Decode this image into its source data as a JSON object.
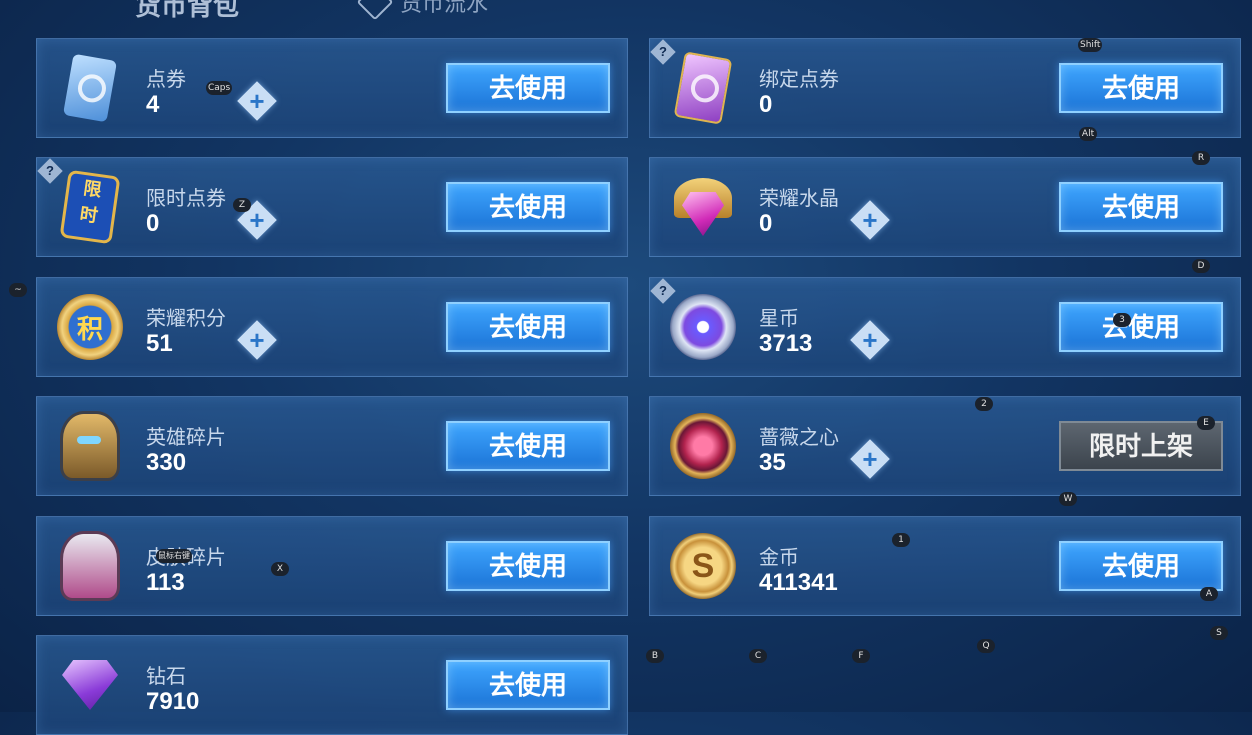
{
  "header": {
    "title": "货币背包",
    "flow_tab": "货币流水"
  },
  "cards": [
    {
      "name": "点券",
      "amount": "4",
      "button": "去使用",
      "icon": "blue-ticket-icon",
      "plus": true,
      "help": false
    },
    {
      "name": "绑定点券",
      "amount": "0",
      "button": "去使用",
      "icon": "purple-ticket-icon",
      "plus": false,
      "help": true
    },
    {
      "name": "限时点券",
      "amount": "0",
      "button": "去使用",
      "icon": "limited-ticket-icon",
      "plus": true,
      "help": true
    },
    {
      "name": "荣耀水晶",
      "amount": "0",
      "button": "去使用",
      "icon": "glory-crystal-icon",
      "plus": true,
      "help": false
    },
    {
      "name": "荣耀积分",
      "amount": "51",
      "button": "去使用",
      "icon": "glory-points-icon",
      "plus": true,
      "help": false
    },
    {
      "name": "星币",
      "amount": "3713",
      "button": "去使用",
      "icon": "star-coin-icon",
      "plus": true,
      "help": true
    },
    {
      "name": "英雄碎片",
      "amount": "330",
      "button": "去使用",
      "icon": "hero-fragment-icon",
      "plus": false,
      "help": false
    },
    {
      "name": "蔷薇之心",
      "amount": "35",
      "button": "限时上架",
      "icon": "rose-heart-icon",
      "plus": true,
      "help": false,
      "disabled": true
    },
    {
      "name": "皮肤碎片",
      "amount": "113",
      "button": "去使用",
      "icon": "skin-fragment-icon",
      "plus": false,
      "help": false
    },
    {
      "name": "金币",
      "amount": "411341",
      "button": "去使用",
      "icon": "gold-coin-icon",
      "plus": false,
      "help": false
    },
    {
      "name": "钻石",
      "amount": "7910",
      "button": "去使用",
      "icon": "diamond-icon",
      "plus": false,
      "help": false
    }
  ],
  "key_hints": [
    "Caps",
    "Shift",
    "Alt",
    "R",
    "Z",
    "D",
    "~",
    "3",
    "2",
    "E",
    "W",
    "1",
    "X",
    "A",
    "S",
    "B",
    "C",
    "F",
    "Q",
    "鼠标右键"
  ]
}
